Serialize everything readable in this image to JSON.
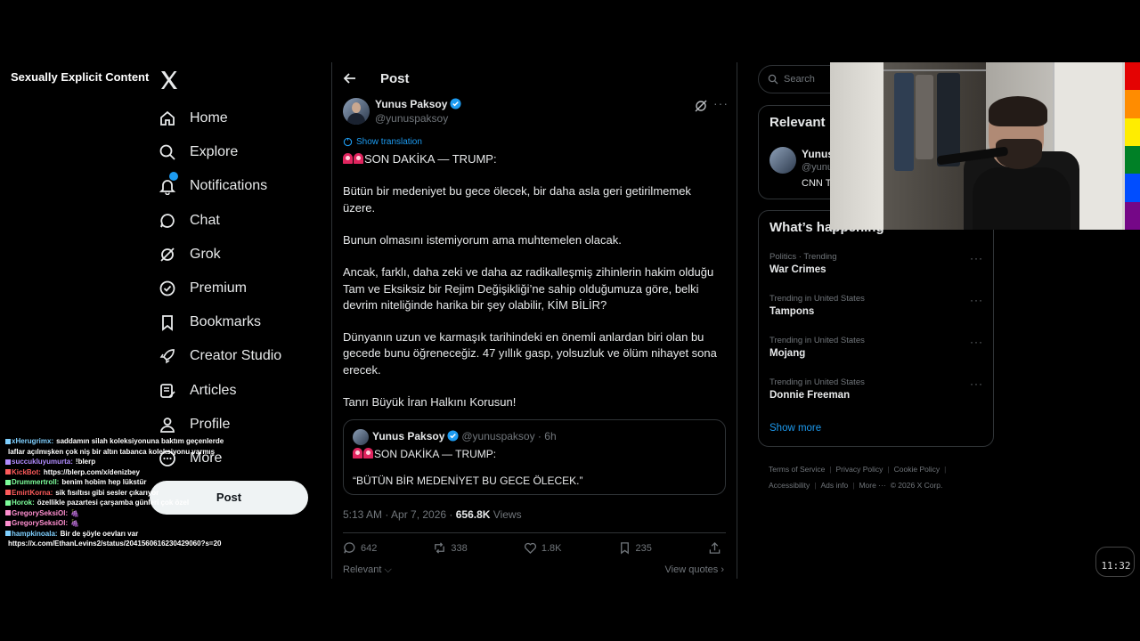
{
  "overlay": {
    "warning_label": "Sexually Explicit Content",
    "clock": "11:32"
  },
  "nav": {
    "items": [
      {
        "label": "Home",
        "icon": "home-icon"
      },
      {
        "label": "Explore",
        "icon": "search-icon"
      },
      {
        "label": "Notifications",
        "icon": "bell-icon"
      },
      {
        "label": "Chat",
        "icon": "chat-icon"
      },
      {
        "label": "Grok",
        "icon": "grok-icon"
      },
      {
        "label": "Premium",
        "icon": "premium-icon"
      },
      {
        "label": "Bookmarks",
        "icon": "bookmark-icon"
      },
      {
        "label": "Creator Studio",
        "icon": "rocket-icon"
      },
      {
        "label": "Articles",
        "icon": "article-icon"
      },
      {
        "label": "Profile",
        "icon": "profile-icon"
      },
      {
        "label": "More",
        "icon": "more-circle-icon"
      }
    ],
    "post_button": "Post"
  },
  "chat": [
    {
      "user": "xHerugrimx:",
      "msg": "saddamın silah koleksiyonuna baktım geçenlerde",
      "color": "#7fd0ff"
    },
    {
      "user": "",
      "msg": "laflar açılmışken çok niş bir altın tabanca koleksiyonu varmış",
      "color": "#7fd0ff"
    },
    {
      "user": "succukluyumurta:",
      "msg": "!blerp",
      "color": "#b18cff"
    },
    {
      "user": "KickBot:",
      "msg": "https://blerp.com/x/denizbey",
      "color": "#ff5b5b"
    },
    {
      "user": "Drummertroll:",
      "msg": "benim hobim hep lükstür",
      "color": "#7dff9b"
    },
    {
      "user": "EmirtKorna:",
      "msg": "sik fısıltısı gibi sesler çıkarıyor",
      "color": "#ff5b5b"
    },
    {
      "user": "Horok:",
      "msg": "özellikle pazartesi çarşamba günleri çok özel",
      "color": "#7dff9b"
    },
    {
      "user": "GregorySeksiOl:",
      "msg": "🍇",
      "color": "#ff8fd0"
    },
    {
      "user": "GregorySeksiOl:",
      "msg": "🍇",
      "color": "#ff8fd0"
    },
    {
      "user": "hampkinoala:",
      "msg": "Bir de şöyle oevları var",
      "color": "#7fd0ff"
    },
    {
      "user": "",
      "msg": "https://x.com/EthanLevins2/status/2041560616230429060?s=20",
      "color": "#ffffff"
    }
  ],
  "post": {
    "header_title": "Post",
    "author_name": "Yunus Paksoy",
    "author_handle": "@yunuspaksoy",
    "show_translation": "Show translation",
    "text": {
      "line1": "SON DAKİKA — TRUMP:",
      "p1": "Bütün bir medeniyet bu gece ölecek, bir daha asla geri getirilmemek üzere.",
      "p2": "Bunun olmasını istemiyorum ama muhtemelen olacak.",
      "p3": "Ancak, farklı, daha zeki ve daha az radikalleşmiş zihinlerin hakim olduğu Tam ve Eksiksiz bir Rejim Değişikliği’ne sahip olduğumuza göre, belki devrim niteliğinde harika bir şey olabilir, KİM BİLİR?",
      "p4": "Dünyanın uzun ve karmaşık tarihindeki en önemli anlardan biri olan bu gecede bunu öğreneceğiz. 47 yıllık gasp, yolsuzluk ve ölüm nihayet sona erecek.",
      "p5": "Tanrı Büyük İran Halkını Korusun!"
    },
    "quote": {
      "name": "Yunus Paksoy",
      "handle_time": "@yunuspaksoy · 6h",
      "line1": "SON DAKİKA — TRUMP:",
      "line2": "“BÜTÜN BİR MEDENİYET BU GECE ÖLECEK.”"
    },
    "timestamp": "5:13 AM · Apr 7, 2026 · ",
    "views_count": "656.8K",
    "views_label": " Views",
    "actions": {
      "replies": "642",
      "reposts": "338",
      "likes": "1.8K",
      "bookmarks": "235"
    },
    "relevant": "Relevant ⌵",
    "view_quotes": "View quotes ›"
  },
  "sidebar": {
    "search_placeholder": "Search",
    "relevant_title": "Relevant",
    "relevant_name": "Yunus",
    "relevant_handle": "@yunu",
    "relevant_bio": "CNN T",
    "happening_title": "What’s happening",
    "trends": [
      {
        "context": "Politics · Trending",
        "name": "War Crimes"
      },
      {
        "context": "Trending in United States",
        "name": "Tampons"
      },
      {
        "context": "Trending in United States",
        "name": "Mojang"
      },
      {
        "context": "Trending in United States",
        "name": "Donnie Freeman"
      }
    ],
    "show_more": "Show more",
    "footer": {
      "terms": "Terms of Service",
      "privacy": "Privacy Policy",
      "cookie": "Cookie Policy",
      "accessibility": "Accessibility",
      "ads": "Ads info",
      "more": "More ···",
      "copyright": "© 2026 X Corp."
    }
  },
  "colors": {
    "accent": "#1d9bf0",
    "background": "#000000",
    "border": "#2f3336",
    "pride": [
      "#e40303",
      "#ff8c00",
      "#ffed00",
      "#008026",
      "#004dff",
      "#750787"
    ]
  }
}
